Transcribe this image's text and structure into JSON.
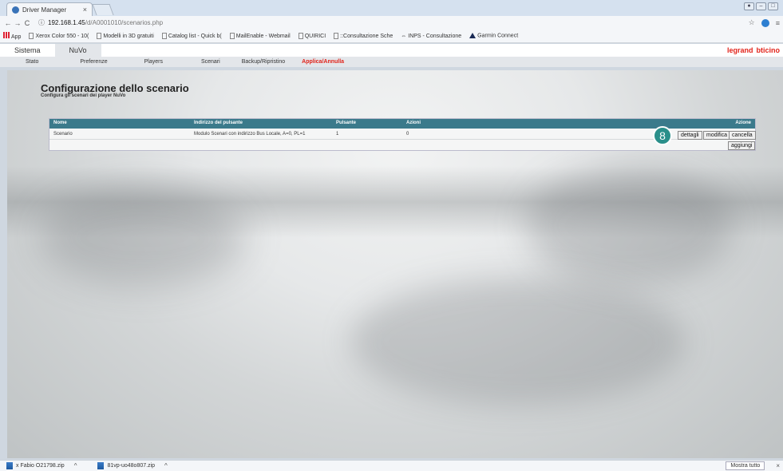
{
  "browser": {
    "tab_title": "Driver Manager",
    "tab_close": "×",
    "url_host": "192.168.1.45",
    "url_path": "/d/A0001010/scenarios.php",
    "bookmarks": [
      {
        "label": "App"
      },
      {
        "label": "Xerox Color 550 - 10("
      },
      {
        "label": "Modelli in 3D gratuiti"
      },
      {
        "label": "Catalog list - Quick b("
      },
      {
        "label": "MailEnable - Webmail"
      },
      {
        "label": "QUIRICI"
      },
      {
        "label": "::Consultazione Sche"
      },
      {
        "label": "INPS - Consultazione"
      },
      {
        "label": "Garmin Connect"
      }
    ]
  },
  "app": {
    "tabs": [
      "Sistema",
      "NuVo"
    ],
    "brand_1": "legrand",
    "brand_2": "bticino",
    "subnav": [
      "Stato",
      "Preferenze",
      "Players",
      "Scenari",
      "Backup/Ripristino",
      "Applica/Annulla"
    ]
  },
  "page": {
    "title": "Configurazione dello scenario",
    "subtitle": "Configura gli scenari dei player NuVo"
  },
  "table": {
    "headers": {
      "nome": "Nome",
      "indirizzo": "Indirizzo del pulsante",
      "pulsante": "Pulsante",
      "azioni": "Azioni",
      "azione": "Azione"
    },
    "rows": [
      {
        "nome": "Scenario",
        "indirizzo": "Modulo Scenari con indirizzo Bus Locale, A=0, PL=1",
        "pulsante": "1",
        "azioni": "0"
      }
    ],
    "buttons": {
      "dettagli": "dettagli",
      "modifica": "modifica",
      "cancella": "cancella",
      "aggiungi": "aggiungi"
    }
  },
  "callout": "8",
  "downloads": {
    "items": [
      {
        "name": "x Fabio O21798.zip"
      },
      {
        "name": "81vp-uo48o807.zip"
      }
    ],
    "caret": "^",
    "show_all": "Mostra tutto",
    "close": "×"
  },
  "colors": {
    "header_teal": "#3b7a8b",
    "callout_teal": "#2a8f8a",
    "accent_red": "#e2231a"
  }
}
